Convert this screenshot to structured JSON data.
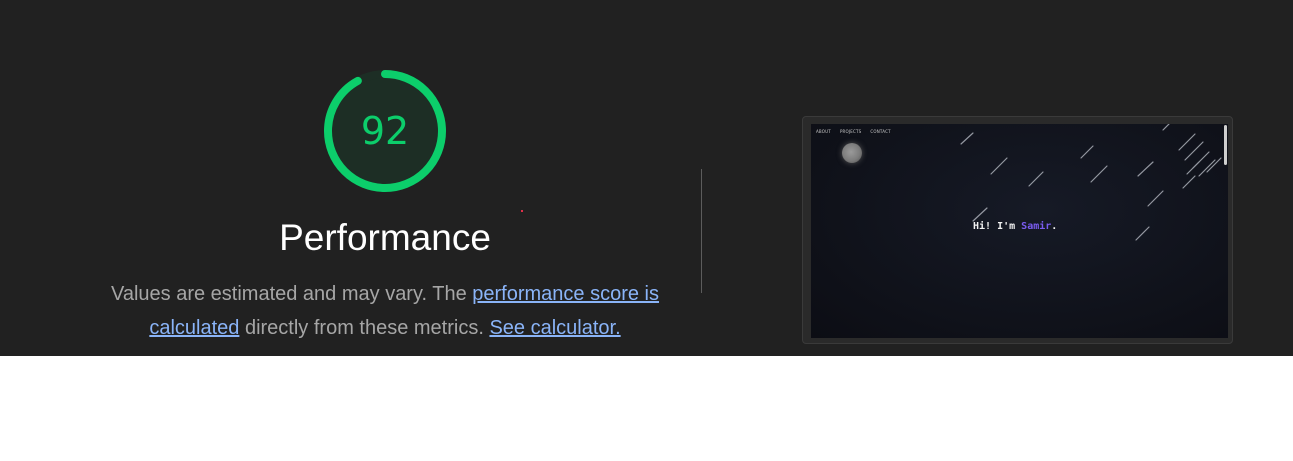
{
  "gauge": {
    "score": "92",
    "score_fraction": 0.92,
    "color": "#0cce6b",
    "track_color": "#1e3a2c"
  },
  "category": {
    "title": "Performance"
  },
  "description": {
    "text_before": "Values are estimated and may vary. The ",
    "link_score": "performance score is calculated",
    "text_middle": " directly from these metrics. ",
    "link_calculator": "See calculator."
  },
  "screenshot": {
    "nav": [
      "ABOUT",
      "PROJECTS",
      "CONTACT"
    ],
    "greeting_prefix": "Hi! I'm ",
    "greeting_name": "Samir",
    "greeting_suffix": ".",
    "name_color": "#7a5cf0"
  }
}
